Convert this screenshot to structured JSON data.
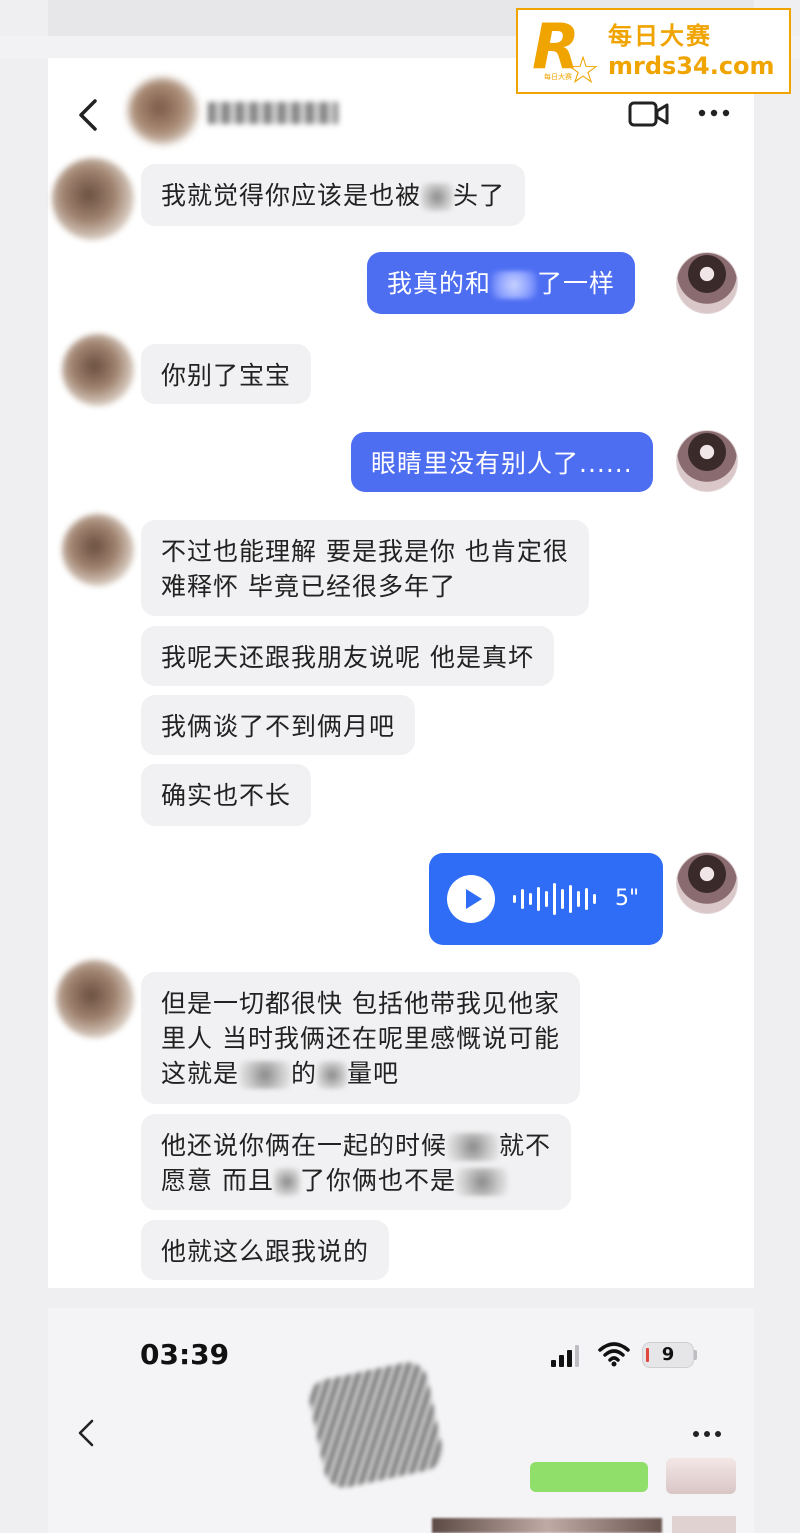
{
  "watermark": {
    "logo_letter": "R",
    "logo_small": "每日大赛",
    "title": "每日大赛",
    "url": "mrds34.com",
    "color": "#f0a400"
  },
  "header": {
    "back_icon": "chevron-left-icon",
    "video_icon": "video-call-icon",
    "more_icon": "more-dots-icon"
  },
  "messages": {
    "m1": {
      "before": "我就觉得你应该是也被",
      "mid": "",
      "after": "头了"
    },
    "m2": {
      "before": "我真的和",
      "after": "了一样"
    },
    "m3": {
      "text": "你别了宝宝"
    },
    "m4": {
      "text": "眼睛里没有别人了......"
    },
    "m5": {
      "line1": "不过也能理解 要是我是你 也肯定很",
      "line2": "难释怀 毕竟已经很多年了"
    },
    "m6": {
      "text": "我呢天还跟我朋友说呢 他是真坏"
    },
    "m7": {
      "text": "我俩谈了不到俩月吧"
    },
    "m8": {
      "text": "确实也不长"
    },
    "voice": {
      "duration": "5\""
    },
    "m9": {
      "line1": "但是一切都很快 包括他带我见他家",
      "line2": "里人 当时我俩还在呢里感慨说可能",
      "line3_before": "这就是",
      "line3_mid": "的",
      "line3_after": "量吧"
    },
    "m10": {
      "line1_before": "他还说你俩在一起的时候",
      "line1_after": "就不",
      "line2_before": "愿意 而且",
      "line2_after": "了你俩也不是"
    },
    "m11": {
      "text": "他就这么跟我说的"
    }
  },
  "lower": {
    "time": "03:39",
    "battery": "9",
    "signal_icon": "cellular-signal-icon",
    "wifi_icon": "wifi-icon"
  },
  "colors": {
    "outgoing_bubble": "#4e6ef2",
    "voice_bubble": "#2f6df6",
    "incoming_bubble": "#f1f1f3"
  }
}
